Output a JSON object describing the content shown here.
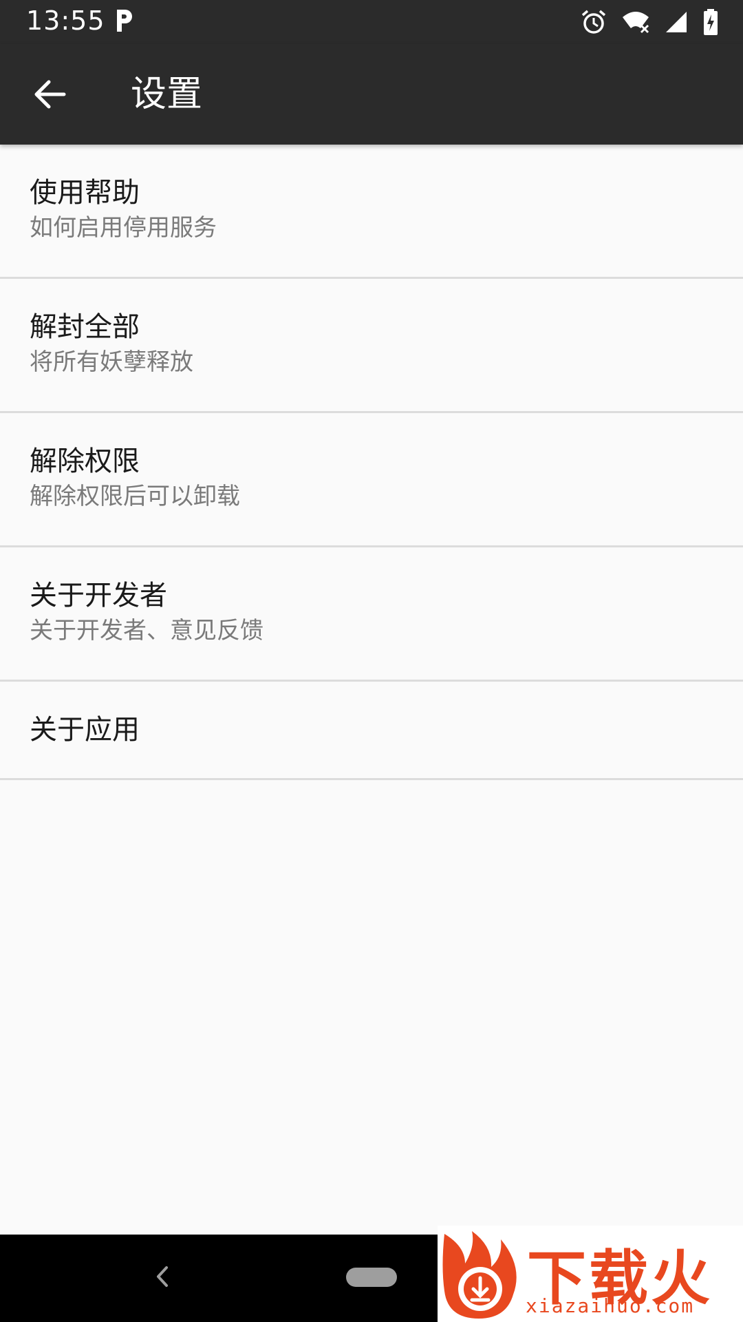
{
  "status_bar": {
    "time": "13:55",
    "icons": [
      "p-icon",
      "alarm-icon",
      "wifi-icon",
      "signal-icon",
      "battery-charging-icon"
    ]
  },
  "toolbar": {
    "title": "设置",
    "back_icon": "arrow-back-icon"
  },
  "settings_list": [
    {
      "title": "使用帮助",
      "subtitle": "如何启用停用服务"
    },
    {
      "title": "解封全部",
      "subtitle": "将所有妖孽释放"
    },
    {
      "title": "解除权限",
      "subtitle": "解除权限后可以卸载"
    },
    {
      "title": "关于开发者",
      "subtitle": "关于开发者、意见反馈"
    },
    {
      "title": "关于应用"
    }
  ],
  "navigation_bar": {
    "icons": [
      "nav-back-icon",
      "nav-home-pill"
    ]
  },
  "watermark": {
    "brand": "下载火",
    "url": "xiazaihuo.com",
    "brand_color": "#e8481f"
  },
  "colors": {
    "toolbar_bg": "#2b2b2b",
    "page_bg": "#fafafa",
    "divider": "#dcdcdc"
  }
}
